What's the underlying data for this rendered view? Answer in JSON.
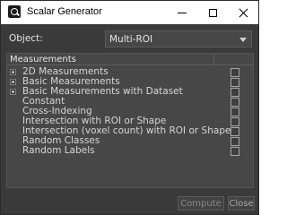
{
  "window": {
    "title": "Scalar Generator",
    "controls": {
      "minimize": "minimize",
      "maximize": "maximize",
      "close": "close"
    }
  },
  "object": {
    "label": "Object:",
    "selected": "Multi-ROI"
  },
  "measurements": {
    "header": "Measurements",
    "items": [
      {
        "label": "2D Measurements",
        "expandable": true,
        "checked": false
      },
      {
        "label": "Basic Measurements",
        "expandable": true,
        "checked": false
      },
      {
        "label": "Basic Measurements with Dataset",
        "expandable": true,
        "checked": false
      },
      {
        "label": "Constant",
        "expandable": false,
        "checked": false
      },
      {
        "label": "Cross-Indexing",
        "expandable": false,
        "checked": false
      },
      {
        "label": "Intersection with ROI or Shape",
        "expandable": false,
        "checked": false
      },
      {
        "label": "Intersection (voxel count) with ROI or Shape",
        "expandable": false,
        "checked": false
      },
      {
        "label": "Random Classes",
        "expandable": false,
        "checked": false
      },
      {
        "label": "Random Labels",
        "expandable": false,
        "checked": false
      }
    ]
  },
  "buttons": {
    "compute": "Compute",
    "close": "Close"
  },
  "colors": {
    "window_bg": "#3a3a3a",
    "panel_bg": "#474747",
    "text": "#d6d6d6",
    "disabled_text": "#8a8a8a"
  }
}
